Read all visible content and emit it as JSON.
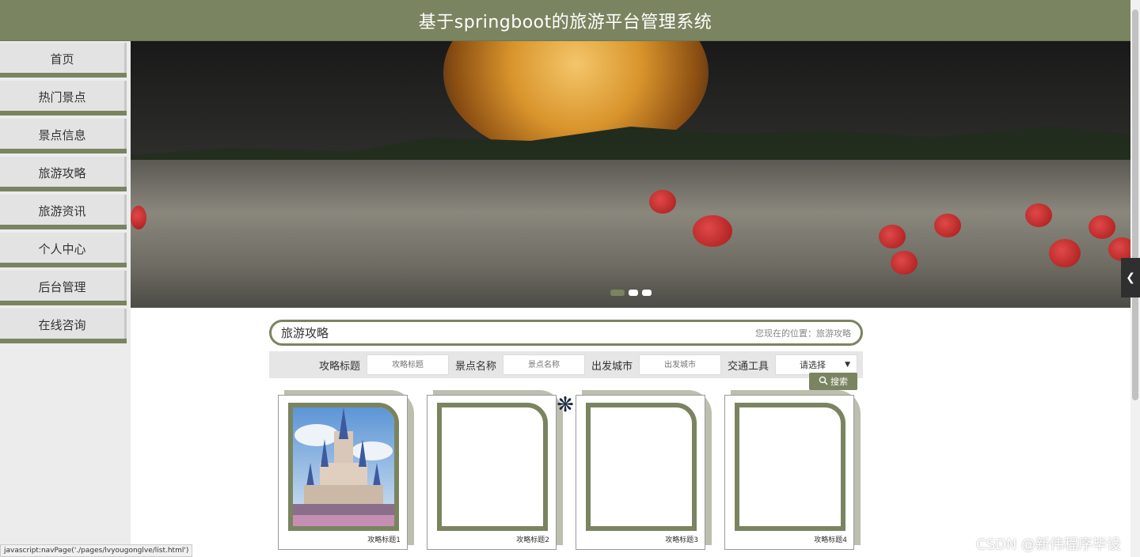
{
  "header": {
    "title": "基于springboot的旅游平台管理系统"
  },
  "sidebar": {
    "items": [
      {
        "label": "首页"
      },
      {
        "label": "热门景点"
      },
      {
        "label": "景点信息"
      },
      {
        "label": "旅游攻略"
      },
      {
        "label": "旅游资讯"
      },
      {
        "label": "个人中心"
      },
      {
        "label": "后台管理"
      },
      {
        "label": "在线咨询"
      }
    ]
  },
  "section": {
    "title": "旅游攻略",
    "breadcrumb": "您现在的位置：旅游攻略"
  },
  "filters": {
    "title_label": "攻略标题",
    "title_placeholder": "攻略标题",
    "spot_label": "景点名称",
    "spot_placeholder": "景点名称",
    "city_label": "出发城市",
    "city_placeholder": "出发城市",
    "transport_label": "交通工具",
    "transport_value": "请选择",
    "search_label": "搜索"
  },
  "cards": [
    {
      "caption": "攻略标题1",
      "has_image": true
    },
    {
      "caption": "攻略标题2",
      "has_image": false
    },
    {
      "caption": "攻略标题3",
      "has_image": false
    },
    {
      "caption": "攻略标题4",
      "has_image": false
    }
  ],
  "banner": {
    "slides": 3,
    "active_slide": 1
  },
  "status_bar": {
    "text": "javascript:navPage('./pages/lvyougonglve/list.html')"
  },
  "watermark": {
    "text": "CSDN @新伟程序毕设"
  },
  "colors": {
    "accent": "#7a8460",
    "card_shadow": "#bcbfae"
  }
}
